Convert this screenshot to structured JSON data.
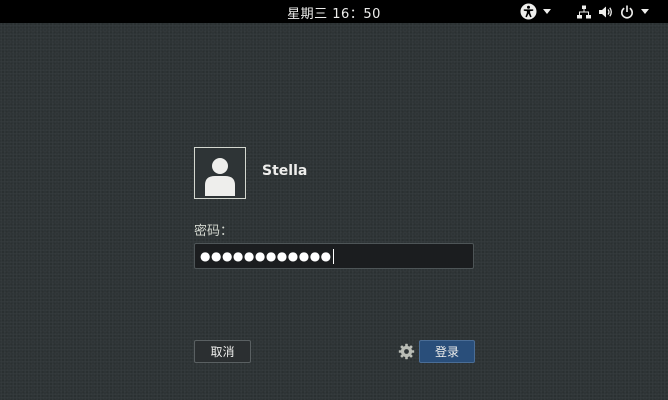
{
  "top_bar": {
    "clock": "星期三 16：50",
    "tray": {
      "accessibility_icon": "accessibility-icon",
      "network_icon": "network-wired-icon",
      "volume_icon": "speaker-volume-icon",
      "power_icon": "power-icon"
    }
  },
  "login": {
    "user": {
      "avatar_icon": "user-avatar-icon",
      "name": "Stella"
    },
    "password_label": "密码：",
    "password_value": "●●●●●●●●●●●●",
    "buttons": {
      "cancel": "取消",
      "login": "登录",
      "session_icon": "gear-icon"
    }
  },
  "colors": {
    "background": "#2e3436",
    "top_bar": "#000000",
    "accent_button": "#294e7a"
  }
}
